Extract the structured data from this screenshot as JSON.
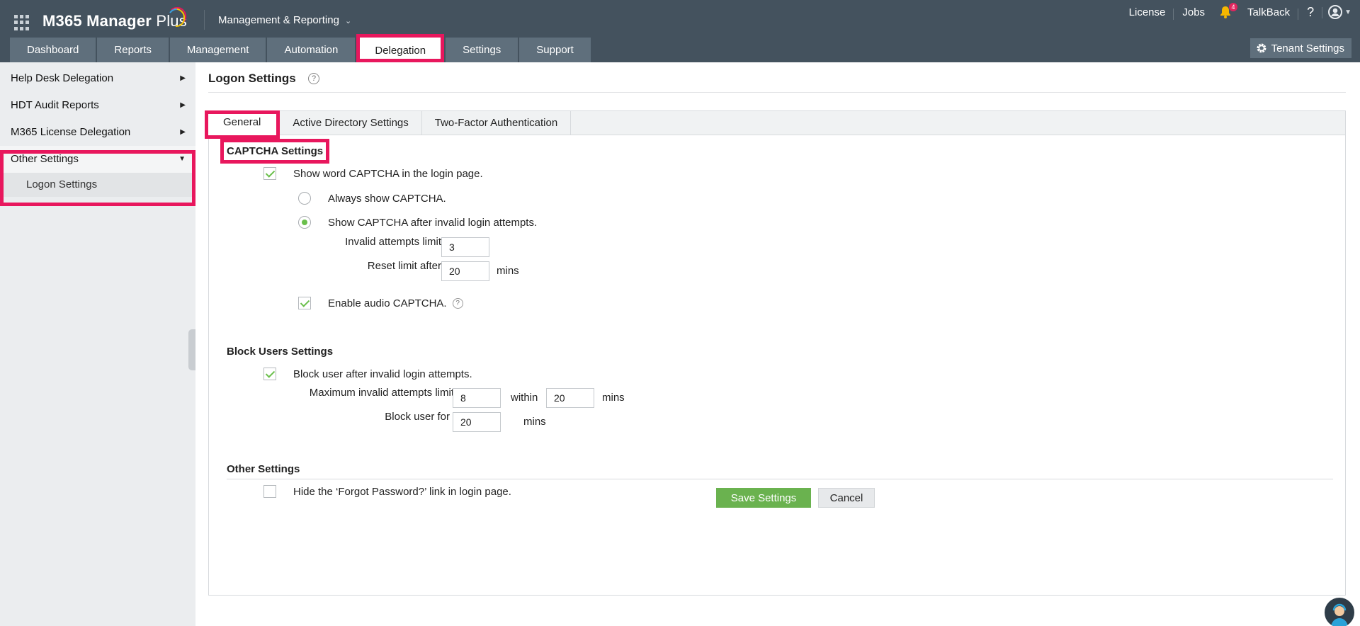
{
  "header": {
    "app_name": "M365 Manager",
    "app_name_suffix": "Plus",
    "product_menu": "Management & Reporting",
    "links": {
      "license": "License",
      "jobs": "Jobs",
      "talkback": "TalkBack",
      "help": "?"
    },
    "notification_count": "4",
    "tenant_settings": "Tenant Settings",
    "tabs": [
      "Dashboard",
      "Reports",
      "Management",
      "Automation",
      "Delegation",
      "Settings",
      "Support"
    ],
    "active_tab": "Delegation"
  },
  "sidebar": {
    "items": [
      {
        "label": "Help Desk Delegation"
      },
      {
        "label": "HDT Audit Reports"
      },
      {
        "label": "M365 License Delegation"
      },
      {
        "label": "Other Settings"
      }
    ],
    "sub_items": [
      {
        "label": "Logon Settings"
      }
    ]
  },
  "main": {
    "title": "Logon Settings",
    "help": "?",
    "tabs": [
      "General",
      "Active Directory Settings",
      "Two-Factor Authentication"
    ],
    "captcha": {
      "title": "CAPTCHA Settings",
      "show_word_captcha": "Show word CAPTCHA in the login page.",
      "show_word_captcha_checked": true,
      "always_show": "Always show CAPTCHA.",
      "after_invalid": "Show CAPTCHA after invalid login attempts.",
      "selected_mode": "after_invalid",
      "invalid_limit_label": "Invalid attempts limit",
      "invalid_limit_value": "3",
      "reset_label": "Reset limit after",
      "reset_value": "20",
      "mins": "mins",
      "audio": "Enable audio CAPTCHA.",
      "audio_checked": true
    },
    "block": {
      "title": "Block Users Settings",
      "block_label": "Block user after invalid login attempts.",
      "block_checked": true,
      "max_label": "Maximum invalid attempts limit",
      "max_value": "8",
      "within": "within",
      "within_value": "20",
      "mins": "mins",
      "block_for_label": "Block user for",
      "block_for_value": "20"
    },
    "other": {
      "title": "Other Settings",
      "hide_forgot": "Hide the ‘Forgot Password?’ link in login page.",
      "hide_forgot_checked": false
    },
    "buttons": {
      "save": "Save Settings",
      "cancel": "Cancel"
    }
  },
  "colors": {
    "header_bg": "#44525e",
    "tab_bg": "#5f6f7c",
    "highlight": "#e8175d",
    "accent_green": "#6ab24f",
    "check_green": "#6abf4b"
  }
}
